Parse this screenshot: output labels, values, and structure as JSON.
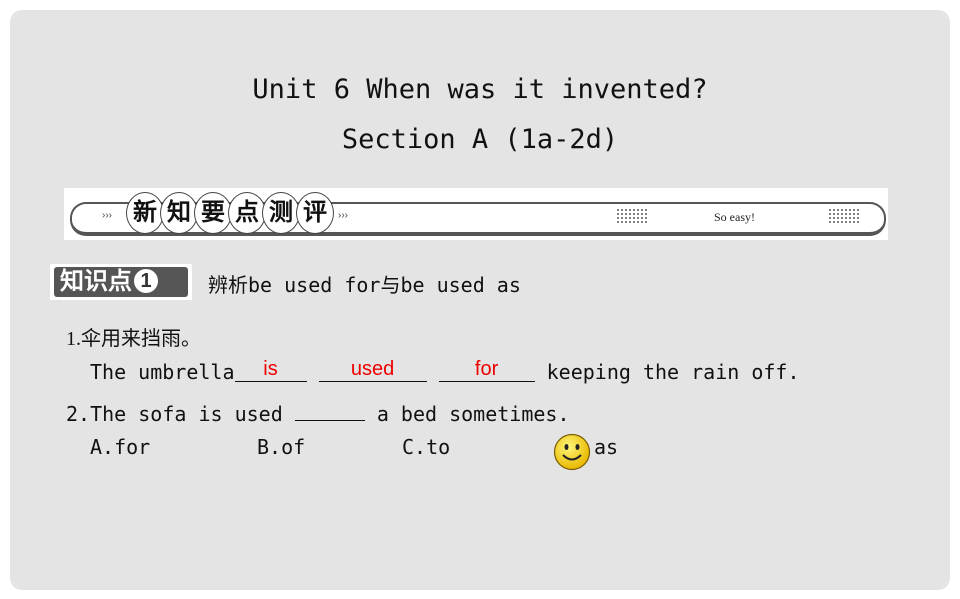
{
  "title": {
    "line1": "Unit 6  When was it invented?",
    "line2": "Section A (1a-2d)"
  },
  "banner": {
    "chars": [
      "新",
      "知",
      "要",
      "点",
      "测",
      "评"
    ],
    "tagline": "So easy!"
  },
  "section": {
    "badge": "知识点",
    "badge_number": "1",
    "heading": "辨析be used for与be used as"
  },
  "q1": {
    "prompt": "1.伞用来挡雨。",
    "lead": "The umbrella",
    "answers": [
      "is",
      "used",
      "for"
    ],
    "tail": " keeping the rain off."
  },
  "q2": {
    "prompt_before": "2.The sofa is used ",
    "prompt_after": " a bed sometimes.",
    "options": [
      "A.for",
      "B.of",
      "C.to",
      "as"
    ],
    "correct_icon": "smiley-icon"
  },
  "colors": {
    "answer": "#e00000",
    "background": "#e4e4e4"
  }
}
